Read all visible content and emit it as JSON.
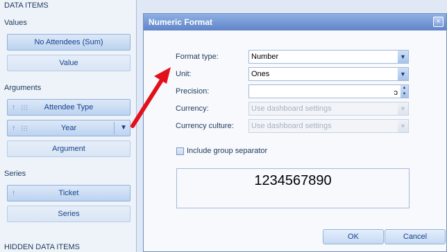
{
  "left_panel": {
    "header": "DATA ITEMS",
    "values": {
      "title": "Values",
      "items": [
        "No Attendees (Sum)",
        "Value"
      ]
    },
    "arguments": {
      "title": "Arguments",
      "items": [
        "Attendee Type",
        "Year",
        "Argument"
      ]
    },
    "series": {
      "title": "Series",
      "items": [
        "Ticket",
        "Series"
      ]
    },
    "hidden_header": "HIDDEN DATA ITEMS"
  },
  "dialog": {
    "title": "Numeric Format",
    "close_glyph": "×",
    "format_type": {
      "label": "Format type:",
      "value": "Number"
    },
    "unit": {
      "label": "Unit:",
      "value": "Ones"
    },
    "precision": {
      "label": "Precision:",
      "value": ""
    },
    "currency": {
      "label": "Currency:",
      "value": "Use dashboard settings"
    },
    "currency_culture": {
      "label": "Currency culture:",
      "value": "Use dashboard settings"
    },
    "group_separator": {
      "label": "Include group separator",
      "checked": false
    },
    "preview": "1234567890",
    "ok": "OK",
    "cancel": "Cancel"
  },
  "colors": {
    "accent": "#5f84c8",
    "annotation": "#e3101b"
  },
  "icons": [
    "move-up-icon",
    "drag-grip-icon",
    "chevron-down-icon",
    "close-icon",
    "dropdown-arrow-icon",
    "spin-icon"
  ]
}
